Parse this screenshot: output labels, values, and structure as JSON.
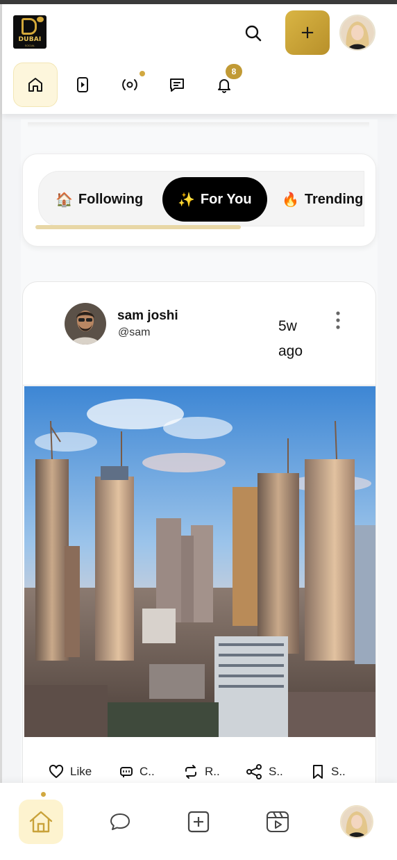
{
  "app": {
    "logo_text": "DUBAI",
    "logo_subtext": "SOCIAL"
  },
  "header": {
    "create_label": "+",
    "notifications_count": "8",
    "icons": [
      "search-icon",
      "plus-icon",
      "home-icon",
      "video-icon",
      "live-icon",
      "chat-icon",
      "bell-icon"
    ]
  },
  "feed_tabs": [
    {
      "emoji": "🏠",
      "label": "Following"
    },
    {
      "emoji": "✨",
      "label": "For You"
    },
    {
      "emoji": "🔥",
      "label": "Trending"
    }
  ],
  "post": {
    "author_name": "sam joshi",
    "author_handle": "@sam",
    "time": "5w ago",
    "actions": [
      {
        "label": "Like",
        "icon": "heart-icon"
      },
      {
        "label": "C..",
        "icon": "comment-icon"
      },
      {
        "label": "R..",
        "icon": "repost-icon"
      },
      {
        "label": "S..",
        "icon": "share-icon"
      },
      {
        "label": "S..",
        "icon": "bookmark-icon"
      }
    ]
  },
  "bottom_nav": {
    "icons": [
      "home-icon",
      "chat-bubble-icon",
      "add-square-icon",
      "reels-icon"
    ]
  },
  "colors": {
    "accent_gold": "#c9a23a",
    "active_bg": "#fdf6dc",
    "tab_active": "#000000"
  }
}
